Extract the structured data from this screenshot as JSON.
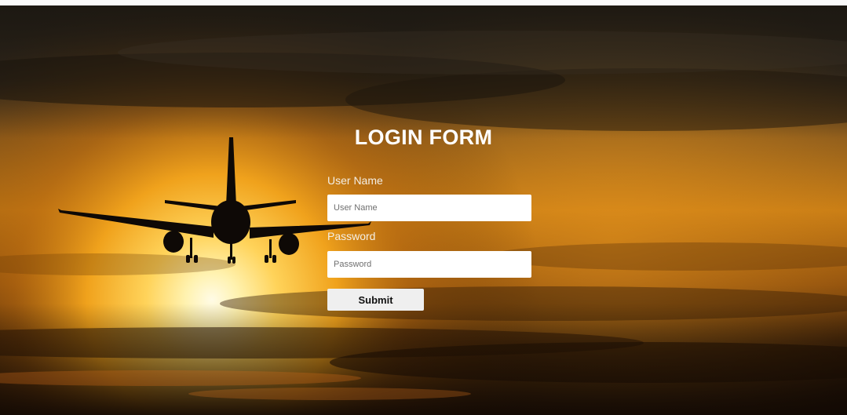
{
  "form": {
    "title": "LOGIN FORM",
    "username": {
      "label": "User Name",
      "placeholder": "User Name",
      "value": ""
    },
    "password": {
      "label": "Password",
      "placeholder": "Password",
      "value": ""
    },
    "submit_label": "Submit"
  },
  "background": {
    "subject": "airplane-silhouette-at-sunset",
    "colors": {
      "sun": "#fff6c8",
      "glow": "#f2a21a",
      "sky_dark": "#1a1208",
      "cloud": "#3a2a14"
    }
  }
}
